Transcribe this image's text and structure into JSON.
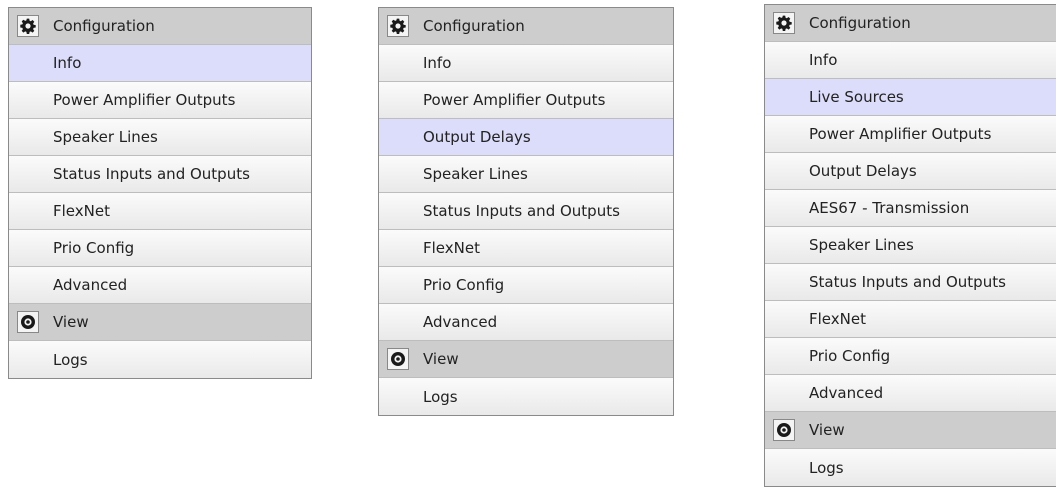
{
  "colors": {
    "header_bg": "#cdcdcd",
    "item_bg": "#efefef",
    "selected_bg": "#dcdcfb",
    "border": "#8a8a8a"
  },
  "panels": [
    {
      "sections": [
        {
          "icon": "gear-icon",
          "title": "Configuration",
          "items": [
            {
              "label": "Info",
              "selected": true
            },
            {
              "label": "Power Amplifier Outputs",
              "selected": false
            },
            {
              "label": "Speaker Lines",
              "selected": false
            },
            {
              "label": "Status Inputs and Outputs",
              "selected": false
            },
            {
              "label": "FlexNet",
              "selected": false
            },
            {
              "label": "Prio Config",
              "selected": false
            },
            {
              "label": "Advanced",
              "selected": false
            }
          ]
        },
        {
          "icon": "eye-icon",
          "title": "View",
          "items": [
            {
              "label": "Logs",
              "selected": false
            }
          ]
        }
      ]
    },
    {
      "sections": [
        {
          "icon": "gear-icon",
          "title": "Configuration",
          "items": [
            {
              "label": "Info",
              "selected": false
            },
            {
              "label": "Power Amplifier Outputs",
              "selected": false
            },
            {
              "label": "Output Delays",
              "selected": true
            },
            {
              "label": "Speaker Lines",
              "selected": false
            },
            {
              "label": "Status Inputs and Outputs",
              "selected": false
            },
            {
              "label": "FlexNet",
              "selected": false
            },
            {
              "label": "Prio Config",
              "selected": false
            },
            {
              "label": "Advanced",
              "selected": false
            }
          ]
        },
        {
          "icon": "eye-icon",
          "title": "View",
          "items": [
            {
              "label": "Logs",
              "selected": false
            }
          ]
        }
      ]
    },
    {
      "sections": [
        {
          "icon": "gear-icon",
          "title": "Configuration",
          "items": [
            {
              "label": "Info",
              "selected": false
            },
            {
              "label": "Live Sources",
              "selected": true
            },
            {
              "label": "Power Amplifier Outputs",
              "selected": false
            },
            {
              "label": "Output Delays",
              "selected": false
            },
            {
              "label": "AES67 - Transmission",
              "selected": false
            },
            {
              "label": "Speaker Lines",
              "selected": false
            },
            {
              "label": "Status Inputs and Outputs",
              "selected": false
            },
            {
              "label": "FlexNet",
              "selected": false
            },
            {
              "label": "Prio Config",
              "selected": false
            },
            {
              "label": "Advanced",
              "selected": false
            }
          ]
        },
        {
          "icon": "eye-icon",
          "title": "View",
          "items": [
            {
              "label": "Logs",
              "selected": false
            }
          ]
        }
      ]
    }
  ]
}
